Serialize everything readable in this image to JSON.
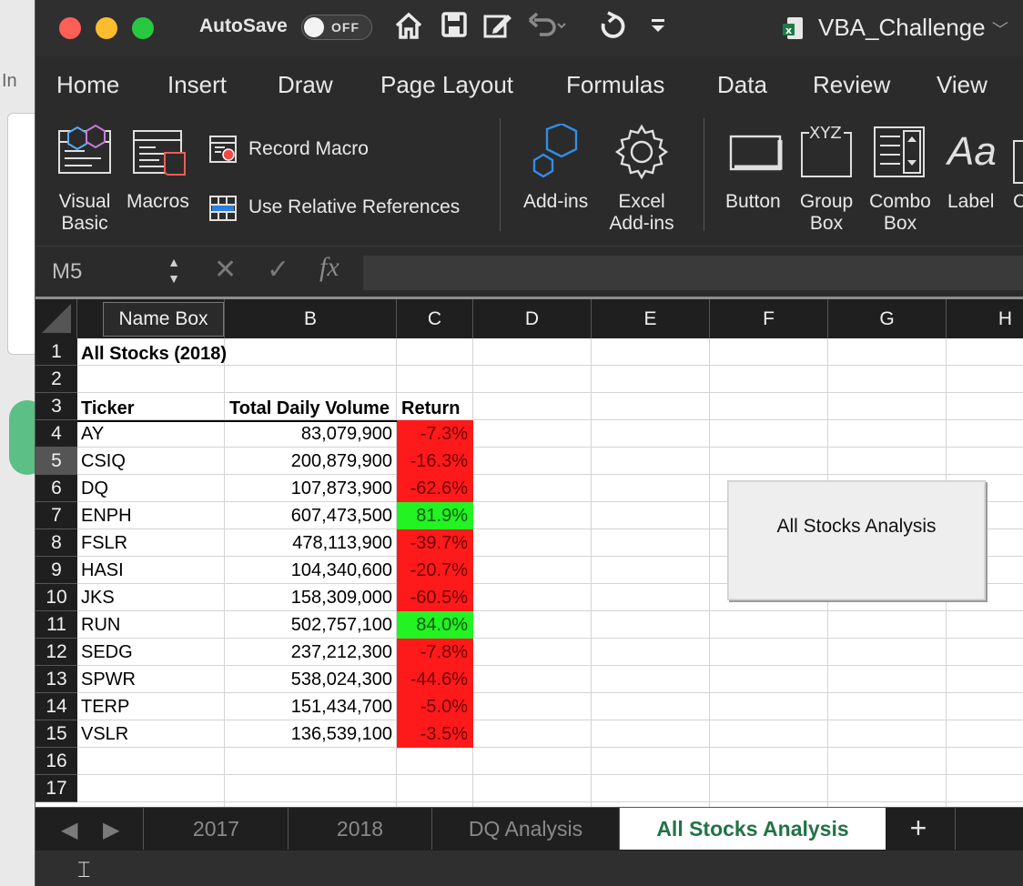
{
  "titlebar": {
    "autosave_label": "AutoSave",
    "autosave_state": "OFF",
    "document_title": "VBA_Challenge",
    "icons": [
      "home-icon",
      "save-icon",
      "edit-icon",
      "undo-icon",
      "redo-icon",
      "customize-icon"
    ]
  },
  "background": {
    "partial_text": "In"
  },
  "ribbon_tabs": [
    "Home",
    "Insert",
    "Draw",
    "Page Layout",
    "Formulas",
    "Data",
    "Review",
    "View"
  ],
  "ribbon": {
    "visual_basic": [
      "Visual",
      "Basic"
    ],
    "macros": "Macros",
    "record_macro": "Record Macro",
    "relative_refs": "Use Relative References",
    "addins": "Add-ins",
    "excel_addins": [
      "Excel",
      "Add-ins"
    ],
    "button": "Button",
    "group_box": [
      "Group",
      "Box"
    ],
    "combo_box": [
      "Combo",
      "Box"
    ],
    "label": "Label",
    "label_icon": "Aa",
    "xyz": "XYZ",
    "partial_next": "C"
  },
  "formula_bar": {
    "name_box": "M5",
    "fx": "fx"
  },
  "grid": {
    "name_box_tooltip": "Name Box",
    "columns": [
      "B",
      "C",
      "D",
      "E",
      "F",
      "G",
      "H"
    ],
    "rows": [
      "1",
      "2",
      "3",
      "4",
      "5",
      "6",
      "7",
      "8",
      "9",
      "10",
      "11",
      "12",
      "13",
      "14",
      "15",
      "16",
      "17"
    ],
    "selected_row": "5",
    "title": "All Stocks (2018)",
    "headers": {
      "ticker": "Ticker",
      "volume": "Total Daily Volume",
      "return": "Return"
    },
    "data": [
      {
        "ticker": "AY",
        "volume": "83,079,900",
        "return": "-7.3%",
        "positive": false
      },
      {
        "ticker": "CSIQ",
        "volume": "200,879,900",
        "return": "-16.3%",
        "positive": false
      },
      {
        "ticker": "DQ",
        "volume": "107,873,900",
        "return": "-62.6%",
        "positive": false
      },
      {
        "ticker": "ENPH",
        "volume": "607,473,500",
        "return": "81.9%",
        "positive": true
      },
      {
        "ticker": "FSLR",
        "volume": "478,113,900",
        "return": "-39.7%",
        "positive": false
      },
      {
        "ticker": "HASI",
        "volume": "104,340,600",
        "return": "-20.7%",
        "positive": false
      },
      {
        "ticker": "JKS",
        "volume": "158,309,000",
        "return": "-60.5%",
        "positive": false
      },
      {
        "ticker": "RUN",
        "volume": "502,757,100",
        "return": "84.0%",
        "positive": true
      },
      {
        "ticker": "SEDG",
        "volume": "237,212,300",
        "return": "-7.8%",
        "positive": false
      },
      {
        "ticker": "SPWR",
        "volume": "538,024,300",
        "return": "-44.6%",
        "positive": false
      },
      {
        "ticker": "TERP",
        "volume": "151,434,700",
        "return": "-5.0%",
        "positive": false
      },
      {
        "ticker": "VSLR",
        "volume": "136,539,100",
        "return": "-3.5%",
        "positive": false
      }
    ],
    "macro_button": "All Stocks Analysis"
  },
  "sheet_tabs": {
    "tabs": [
      "2017",
      "2018",
      "DQ Analysis",
      "All Stocks Analysis"
    ],
    "active": "All Stocks Analysis",
    "add": "+"
  },
  "colors": {
    "negative": "#fe1a1a",
    "positive": "#23f223",
    "active_tab": "#217346"
  }
}
